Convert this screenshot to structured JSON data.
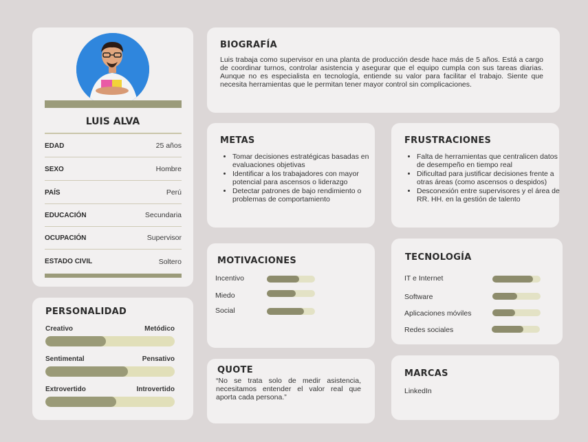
{
  "profile": {
    "name": "LUIS ALVA",
    "rows": [
      {
        "label": "EDAD",
        "value": "25 años"
      },
      {
        "label": "SEXO",
        "value": "Hombre"
      },
      {
        "label": "PAÍS",
        "value": "Perú"
      },
      {
        "label": "EDUCACIÓN",
        "value": "Secundaria"
      },
      {
        "label": "OCUPACIÓN",
        "value": "Supervisor"
      },
      {
        "label": "ESTADO CIVIL",
        "value": "Soltero"
      }
    ]
  },
  "personality": {
    "title": "PERSONALIDAD",
    "traits": [
      {
        "left": "Creativo",
        "right": "Metódico",
        "level": 0.47
      },
      {
        "left": "Sentimental",
        "right": "Pensativo",
        "level": 0.64
      },
      {
        "left": "Extrovertido",
        "right": "Introvertido",
        "level": 0.55
      }
    ]
  },
  "biography": {
    "title": "BIOGRAFÍA",
    "text": "Luis trabaja como supervisor en una planta de producción desde hace más de 5 años. Está a cargo de coordinar turnos, controlar asistencia y asegurar que el equipo cumpla con sus tareas diarias. Aunque no es especialista en tecnología, entiende su valor para facilitar el trabajo. Siente que necesita herramientas que le permitan tener mayor control sin complicaciones."
  },
  "goals": {
    "title": "METAS",
    "items": [
      "Tomar decisiones estratégicas basadas en evaluaciones objetivas",
      "Identificar a los trabajadores con mayor potencial para ascensos o liderazgo",
      "Detectar patrones de bajo rendimiento o problemas de comportamiento"
    ]
  },
  "frustrations": {
    "title": "FRUSTRACIONES",
    "items": [
      "Falta de herramientas que centralicen datos de desempeño en tiempo real",
      "Dificultad para justificar decisiones frente a otras áreas (como ascensos o despidos)",
      "Desconexión entre supervisores y el área de RR. HH. en la gestión de talento"
    ]
  },
  "motivations": {
    "title": "MOTIVACIONES",
    "items": [
      {
        "label": "Incentivo",
        "level": 0.67
      },
      {
        "label": "Miedo",
        "level": 0.6
      },
      {
        "label": "Social",
        "level": 0.77
      }
    ]
  },
  "technology": {
    "title": "TECNOLOGÍA",
    "items": [
      {
        "label": "IT e Internet",
        "level": 0.84
      },
      {
        "label": "Software",
        "level": 0.52
      },
      {
        "label": "Aplicaciones móviles",
        "level": 0.47
      },
      {
        "label": "Redes sociales",
        "level": 0.66
      }
    ]
  },
  "quote": {
    "title": "QUOTE",
    "text": "“No se trata solo de medir asistencia, necesitamos entender el valor real que aporta cada persona.”"
  },
  "brands": {
    "title": "MARCAS",
    "items": [
      "LinkedIn"
    ]
  }
}
